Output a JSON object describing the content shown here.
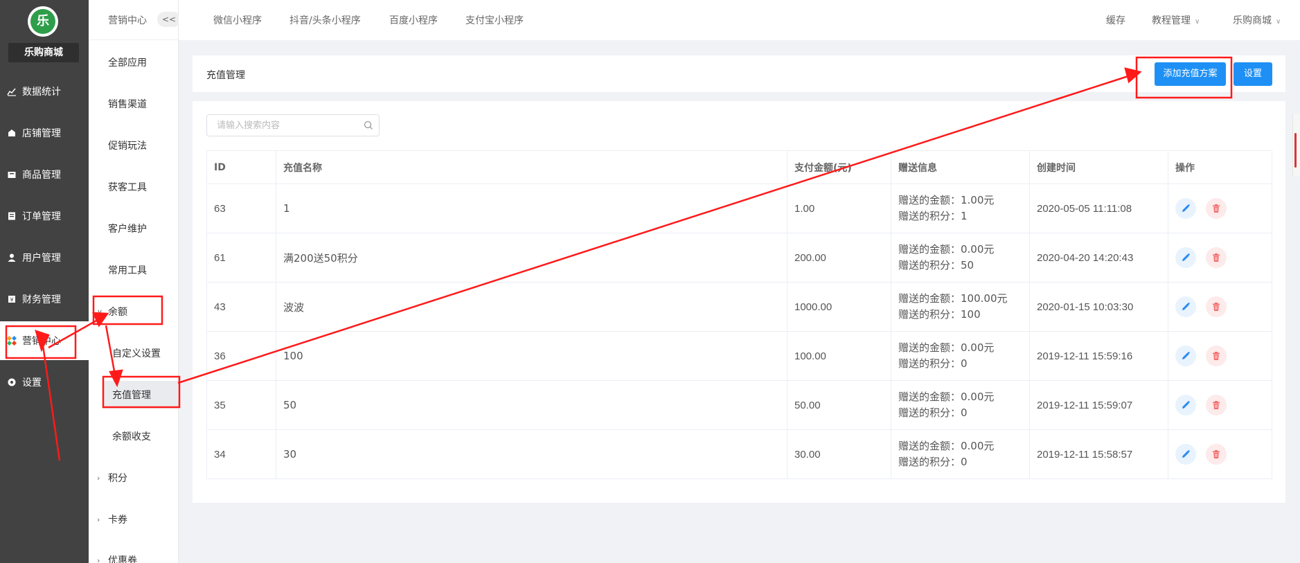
{
  "app": {
    "store_name": "乐购商城",
    "logo_glyph": "乐"
  },
  "sidebar": {
    "items": [
      {
        "label": "数据统计",
        "icon": "chart-line-icon"
      },
      {
        "label": "店铺管理",
        "icon": "shop-icon"
      },
      {
        "label": "商品管理",
        "icon": "goods-icon"
      },
      {
        "label": "订单管理",
        "icon": "order-icon"
      },
      {
        "label": "用户管理",
        "icon": "user-icon"
      },
      {
        "label": "财务管理",
        "icon": "finance-icon"
      },
      {
        "label": "营销中心",
        "icon": "marketing-icon",
        "active": true
      },
      {
        "label": "设置",
        "icon": "gear-icon"
      }
    ]
  },
  "subnav": {
    "title": "营销中心",
    "collapse_label": "<<",
    "items": [
      {
        "label": "全部应用"
      },
      {
        "label": "销售渠道"
      },
      {
        "label": "促销玩法"
      },
      {
        "label": "获客工具"
      },
      {
        "label": "客户维护"
      },
      {
        "label": "常用工具"
      },
      {
        "label": "余额",
        "group": true,
        "expanded": true
      },
      {
        "label": "自定义设置",
        "child": true
      },
      {
        "label": "充值管理",
        "child": true,
        "selected": true
      },
      {
        "label": "余额收支",
        "child": true
      },
      {
        "label": "积分",
        "group": true
      },
      {
        "label": "卡券",
        "group": true
      },
      {
        "label": "优惠券",
        "group": true
      }
    ]
  },
  "topbar": {
    "tabs": [
      "微信小程序",
      "抖音/头条小程序",
      "百度小程序",
      "支付宝小程序"
    ],
    "right": [
      {
        "label": "缓存",
        "dropdown": false
      },
      {
        "label": "教程管理",
        "dropdown": true
      },
      {
        "label": "乐购商城",
        "dropdown": true
      }
    ]
  },
  "page": {
    "title": "充值管理",
    "add_button": "添加充值方案",
    "settings_button": "设置",
    "search_placeholder": "请输入搜索内容"
  },
  "table": {
    "headers": [
      "ID",
      "充值名称",
      "支付金额(元)",
      "赠送信息",
      "创建时间",
      "操作"
    ],
    "rows": [
      {
        "id": "63",
        "name": "1",
        "amount": "1.00",
        "gift_amount": "赠送的金额：1.00元",
        "gift_points": "赠送的积分：1",
        "created": "2020-05-05 11:11:08"
      },
      {
        "id": "61",
        "name": "满200送50积分",
        "amount": "200.00",
        "gift_amount": "赠送的金额：0.00元",
        "gift_points": "赠送的积分：50",
        "created": "2020-04-20 14:20:43"
      },
      {
        "id": "43",
        "name": "波波",
        "amount": "1000.00",
        "gift_amount": "赠送的金额：100.00元",
        "gift_points": "赠送的积分：100",
        "created": "2020-01-15 10:03:30"
      },
      {
        "id": "36",
        "name": "100",
        "amount": "100.00",
        "gift_amount": "赠送的金额：0.00元",
        "gift_points": "赠送的积分：0",
        "created": "2019-12-11 15:59:16"
      },
      {
        "id": "35",
        "name": "50",
        "amount": "50.00",
        "gift_amount": "赠送的金额：0.00元",
        "gift_points": "赠送的积分：0",
        "created": "2019-12-11 15:59:07"
      },
      {
        "id": "34",
        "name": "30",
        "amount": "30.00",
        "gift_amount": "赠送的金额：0.00元",
        "gift_points": "赠送的积分：0",
        "created": "2019-12-11 15:58:57"
      }
    ]
  },
  "colors": {
    "sidebar_bg": "#424242",
    "primary": "#1e90f5",
    "annotation": "#ff1a1a",
    "edit_icon": "#2d8cf0",
    "delete_icon": "#f56c6c"
  }
}
